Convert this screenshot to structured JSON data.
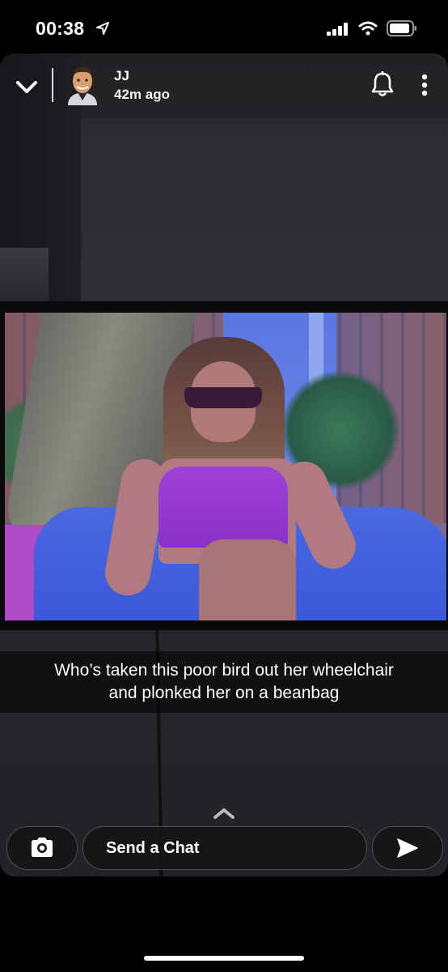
{
  "status_bar": {
    "time": "00:38",
    "icons": [
      "location-arrow-icon",
      "signal-icon",
      "wifi-icon",
      "battery-icon"
    ]
  },
  "header": {
    "sender_name": "JJ",
    "timestamp": "42m ago",
    "icons": [
      "chevron-down-icon",
      "bell-icon",
      "more-vertical-icon"
    ]
  },
  "caption": {
    "line1": "Who’s taken this poor bird out her wheelchair",
    "line2": "and plonked her on a beanbag"
  },
  "composer": {
    "camera_icon": "camera-icon",
    "placeholder": "Send a Chat",
    "send_icon": "send-arrow-icon",
    "swipe_icon": "chevron-up-icon"
  },
  "colors": {
    "background": "#000000",
    "text": "#ffffff"
  }
}
